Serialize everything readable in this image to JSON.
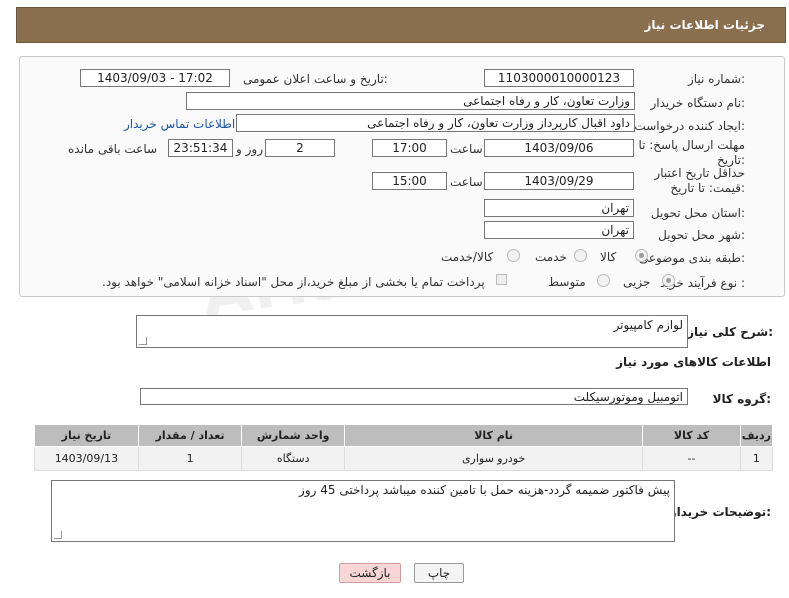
{
  "header": {
    "title": "جزئیات اطلاعات نیاز"
  },
  "form": {
    "need_number_label": "شماره نیاز:",
    "need_number": "1103000010000123",
    "announce_label": "تاریخ و ساعت اعلان عمومی:",
    "announce_value": "1403/09/03 - 17:02",
    "buyer_org_label": "نام دستگاه خریدار:",
    "buyer_org": "وزارت تعاون، کار و رفاه اجتماعی",
    "creator_label": "ایجاد کننده درخواست:",
    "creator": "داود اقبال کارپرداز وزارت تعاون، کار و رفاه اجتماعی",
    "contact_link": "اطلاعات تماس خریدار",
    "deadline_label": "مهلت ارسال پاسخ: تا تاریخ:",
    "deadline_date": "1403/09/06",
    "time_label": "ساعت",
    "deadline_time": "17:00",
    "days_value": "2",
    "days_label": "روز و",
    "remaining_time": "23:51:34",
    "remaining_label": "ساعت باقی مانده",
    "validity_label": "حداقل تاریخ اعتبار قیمت: تا تاریخ:",
    "validity_date": "1403/09/29",
    "validity_time": "15:00",
    "province_label": "استان محل تحویل:",
    "province": "تهران",
    "city_label": "شهر محل تحویل:",
    "city": "تهران",
    "category_label": "طبقه بندی موضوعی:",
    "category_options": [
      "کالا",
      "خدمت",
      "کالا/خدمت"
    ],
    "process_label": "نوع فرآیند خرید :",
    "process_options": [
      "جزیی",
      "متوسط"
    ],
    "payment_note": "پرداخت تمام یا بخشی از مبلغ خرید،از محل \"اسناد خزانه اسلامی\" خواهد بود."
  },
  "description": {
    "label": "شرح کلی نیاز:",
    "value": "لوازم کامپیوتر"
  },
  "goods_section": {
    "title": "اطلاعات کالاهای مورد نیاز",
    "group_label": "گروه کالا:",
    "group_value": "اتومبیل وموتورسیکلت"
  },
  "table": {
    "headers": [
      "ردیف",
      "کد کالا",
      "نام کالا",
      "واحد شمارش",
      "تعداد / مقدار",
      "تاریخ نیاز"
    ],
    "rows": [
      [
        "1",
        "--",
        "خودرو سواری",
        "دستگاه",
        "1",
        "1403/09/13"
      ]
    ]
  },
  "buyer_notes": {
    "label": "توضیحات خریدار:",
    "value": "پیش فاکتور ضمیمه گردد-هزینه حمل با تامین کننده میباشد پرداختی 45 روز"
  },
  "buttons": {
    "print": "چاپ",
    "back": "بازگشت"
  },
  "watermark": "AriaTender.neT"
}
